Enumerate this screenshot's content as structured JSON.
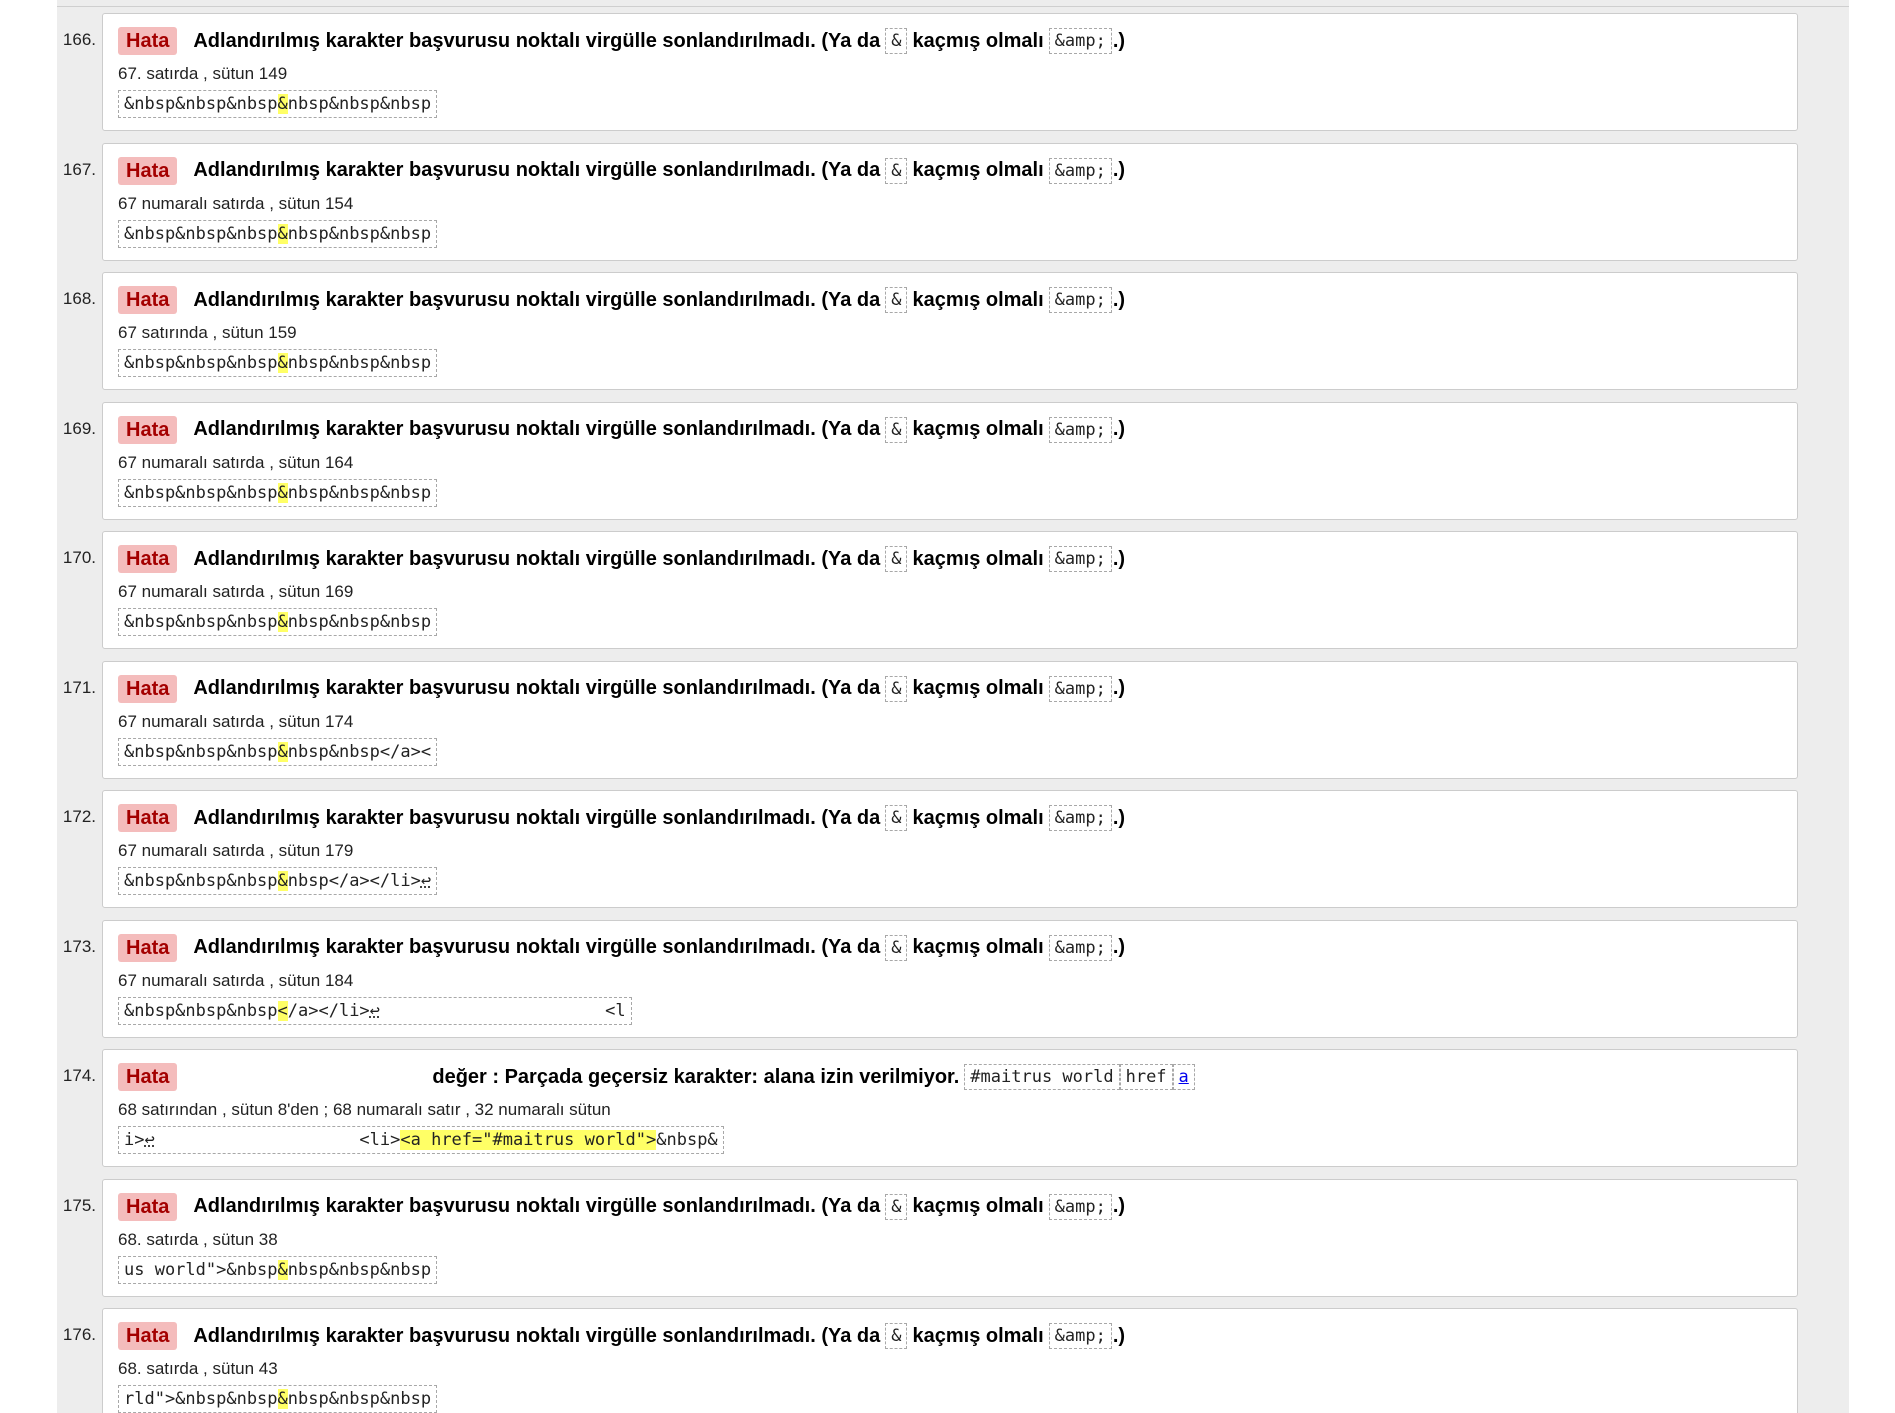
{
  "colors": {
    "badge_bg": "#f4bcbc",
    "badge_text": "#a40000",
    "highlight": "#ffff66",
    "panel_bg": "#ededed"
  },
  "messages": [
    {
      "num": "166.",
      "badge": "Hata",
      "parts": [
        "Adlandırılmış karakter başvurusu noktalı virgülle sonlandırılmadı. (Ya da",
        "&",
        "kaçmış olmalı",
        "&amp;",
        ".)"
      ],
      "location": "67. satırda , sütun 149",
      "extract": [
        "&nbsp&nbsp&nbsp",
        "&",
        "nbsp&nbsp&nbsp",
        ""
      ]
    },
    {
      "num": "167.",
      "badge": "Hata",
      "parts": [
        "Adlandırılmış karakter başvurusu noktalı virgülle sonlandırılmadı. (Ya da",
        "&",
        "kaçmış olmalı",
        "&amp;",
        ".)"
      ],
      "location": "67 numaralı satırda , sütun 154",
      "extract": [
        "&nbsp&nbsp&nbsp",
        "&",
        "nbsp&nbsp&nbsp",
        ""
      ]
    },
    {
      "num": "168.",
      "badge": "Hata",
      "parts": [
        "Adlandırılmış karakter başvurusu noktalı virgülle sonlandırılmadı. (Ya da",
        "&",
        "kaçmış olmalı",
        "&amp;",
        ".)"
      ],
      "location": "67 satırında , sütun 159",
      "extract": [
        "&nbsp&nbsp&nbsp",
        "&",
        "nbsp&nbsp&nbsp",
        ""
      ]
    },
    {
      "num": "169.",
      "badge": "Hata",
      "parts": [
        "Adlandırılmış karakter başvurusu noktalı virgülle sonlandırılmadı. (Ya da",
        "&",
        "kaçmış olmalı",
        "&amp;",
        ".)"
      ],
      "location": "67 numaralı satırda , sütun 164",
      "extract": [
        "&nbsp&nbsp&nbsp",
        "&",
        "nbsp&nbsp&nbsp",
        ""
      ]
    },
    {
      "num": "170.",
      "badge": "Hata",
      "parts": [
        "Adlandırılmış karakter başvurusu noktalı virgülle sonlandırılmadı. (Ya da",
        "&",
        "kaçmış olmalı",
        "&amp;",
        ".)"
      ],
      "location": "67 numaralı satırda , sütun 169",
      "extract": [
        "&nbsp&nbsp&nbsp",
        "&",
        "nbsp&nbsp&nbsp",
        ""
      ]
    },
    {
      "num": "171.",
      "badge": "Hata",
      "parts": [
        "Adlandırılmış karakter başvurusu noktalı virgülle sonlandırılmadı. (Ya da",
        "&",
        "kaçmış olmalı",
        "&amp;",
        ".)"
      ],
      "location": "67 numaralı satırda , sütun 174",
      "extract": [
        "&nbsp&nbsp&nbsp",
        "&",
        "nbsp&nbsp</a><",
        ""
      ]
    },
    {
      "num": "172.",
      "badge": "Hata",
      "parts": [
        "Adlandırılmış karakter başvurusu noktalı virgülle sonlandırılmadı. (Ya da",
        "&",
        "kaçmış olmalı",
        "&amp;",
        ".)"
      ],
      "location": "67 numaralı satırda , sütun 179",
      "extract": [
        "&nbsp&nbsp&nbsp",
        "&",
        "nbsp</a></li>",
        "↩"
      ]
    },
    {
      "num": "173.",
      "badge": "Hata",
      "parts": [
        "Adlandırılmış karakter başvurusu noktalı virgülle sonlandırılmadı. (Ya da",
        "&",
        "kaçmış olmalı",
        "&amp;",
        ".)"
      ],
      "location": "67 numaralı satırda , sütun 184",
      "extract": [
        "&nbsp&nbsp&nbsp",
        "<",
        "/a></li>",
        "↩",
        "                      <l"
      ]
    },
    {
      "num": "174.",
      "badge": "Hata",
      "parts": [
        "değer : Parçada geçersiz karakter: alana izin verilmiyor.",
        "#maitrus world",
        "href",
        "a"
      ],
      "location": "68 satırından , sütun 8'den ; 68 numaralı satır , 32 numaralı sütun",
      "extract": [
        "i>",
        "↩",
        "                    <li>",
        "<a href=\"#maitrus world\">",
        "&nbsp&"
      ]
    },
    {
      "num": "175.",
      "badge": "Hata",
      "parts": [
        "Adlandırılmış karakter başvurusu noktalı virgülle sonlandırılmadı. (Ya da",
        "&",
        "kaçmış olmalı",
        "&amp;",
        ".)"
      ],
      "location": "68. satırda , sütun 38",
      "extract": [
        "us world\">&nbsp",
        "&",
        "nbsp&nbsp&nbsp",
        ""
      ]
    },
    {
      "num": "176.",
      "badge": "Hata",
      "parts": [
        "Adlandırılmış karakter başvurusu noktalı virgülle sonlandırılmadı. (Ya da",
        "&",
        "kaçmış olmalı",
        "&amp;",
        ".)"
      ],
      "location": "68. satırda , sütun 43",
      "extract": [
        "rld\">&nbsp&nbsp",
        "&",
        "nbsp&nbsp&nbsp",
        ""
      ]
    }
  ]
}
